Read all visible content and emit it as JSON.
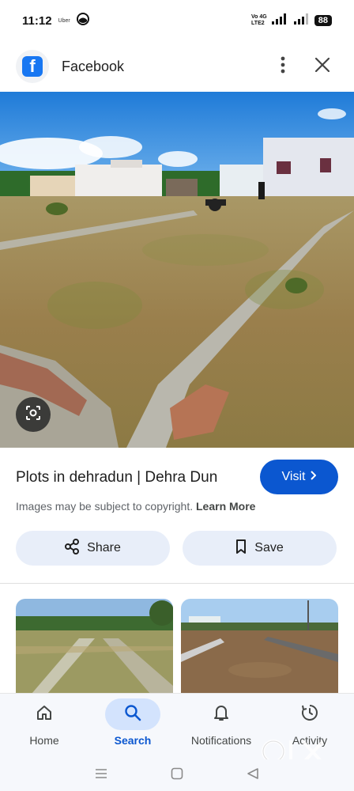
{
  "status_bar": {
    "time": "11:12",
    "app_indicator": "Uber",
    "network_top": "Vo 4G",
    "network_bottom": "LTE2",
    "battery": "88"
  },
  "header": {
    "app_name": "Facebook",
    "more_icon": "more-vert-icon",
    "close_icon": "close-icon"
  },
  "result": {
    "title": "Plots in dehradun | Dehra Dun",
    "visit_label": "Visit",
    "copyright_text": "Images may be subject to copyright.",
    "learn_more": "Learn More"
  },
  "actions": {
    "share_label": "Share",
    "save_label": "Save"
  },
  "bottom_nav": {
    "items": [
      {
        "label": "Home",
        "icon": "home-icon",
        "active": false
      },
      {
        "label": "Search",
        "icon": "search-icon",
        "active": true
      },
      {
        "label": "Notifications",
        "icon": "bell-icon",
        "active": false
      },
      {
        "label": "Activity",
        "icon": "activity-icon",
        "active": false
      }
    ]
  },
  "watermark": "olx",
  "colors": {
    "accent": "#0b57d0",
    "pill_bg": "#e8eef9",
    "active_nav_bg": "#d3e3fd",
    "facebook_blue": "#1877f2"
  }
}
